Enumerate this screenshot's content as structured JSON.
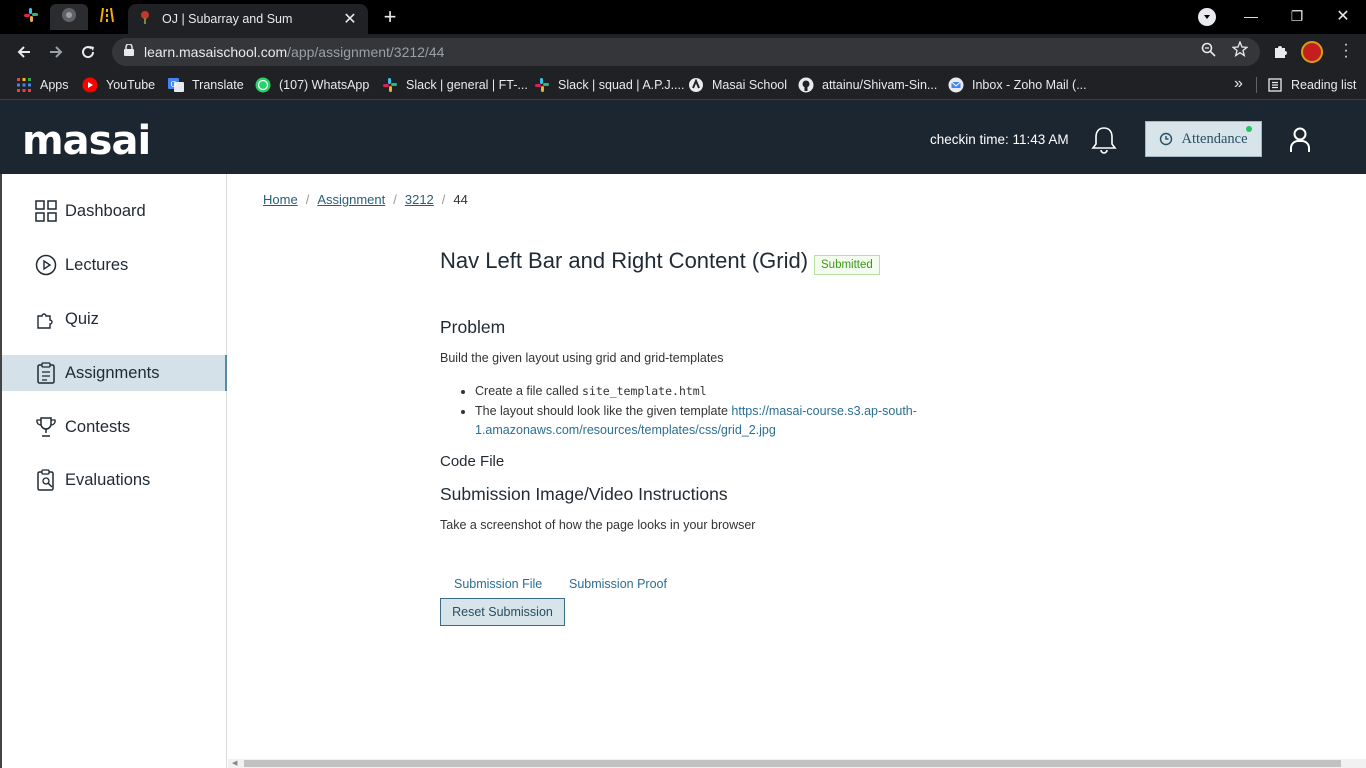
{
  "browser": {
    "active_tab_title": "OJ | Subarray and Sum",
    "url_host": "learn.masaischool.com",
    "url_path": "/app/assignment/3212/44",
    "bookmarks": [
      {
        "label": "Apps",
        "icon": "apps-grid-icon"
      },
      {
        "label": "YouTube",
        "icon": "youtube-icon"
      },
      {
        "label": "Translate",
        "icon": "translate-icon"
      },
      {
        "label": "(107) WhatsApp",
        "icon": "whatsapp-icon"
      },
      {
        "label": "Slack | general | FT-...",
        "icon": "slack-icon"
      },
      {
        "label": "Slack | squad | A.P.J....",
        "icon": "slack-icon"
      },
      {
        "label": "Masai School",
        "icon": "masai-icon"
      },
      {
        "label": "attainu/Shivam-Sin...",
        "icon": "github-icon"
      },
      {
        "label": "Inbox - Zoho Mail (...",
        "icon": "zoho-mail-icon"
      }
    ],
    "more_bookmarks": "»",
    "reading_list": "Reading list"
  },
  "header": {
    "logo": "masai",
    "checkin": "checkin time: 11:43 AM",
    "attendance": "Attendance"
  },
  "sidebar": {
    "items": [
      {
        "label": "Dashboard",
        "icon": "dashboard-grid-icon"
      },
      {
        "label": "Lectures",
        "icon": "play-circle-icon"
      },
      {
        "label": "Quiz",
        "icon": "puzzle-icon"
      },
      {
        "label": "Assignments",
        "icon": "clipboard-icon",
        "active": true
      },
      {
        "label": "Contests",
        "icon": "trophy-icon"
      },
      {
        "label": "Evaluations",
        "icon": "evaluation-icon"
      }
    ]
  },
  "breadcrumb": {
    "items": [
      "Home",
      "Assignment",
      "3212"
    ],
    "current": "44",
    "separator": "/"
  },
  "assignment": {
    "title": "Nav Left Bar and Right Content (Grid)",
    "status": "Submitted",
    "problem_heading": "Problem",
    "problem_text": "Build the given layout using grid and grid-templates",
    "bullet1_prefix": "Create a file called ",
    "bullet1_code": "site_template.html",
    "bullet2_prefix": "The layout should look like the given template ",
    "bullet2_link": "https://masai-course.s3.ap-south-1.amazonaws.com/resources/templates/css/grid_2.jpg",
    "code_file_heading": "Code File",
    "submission_heading": "Submission Image/Video Instructions",
    "submission_text": "Take a screenshot of how the page looks in your browser",
    "submission_file": "Submission File",
    "submission_proof": "Submission Proof",
    "reset_button": "Reset Submission"
  },
  "colors": {
    "header_bg": "#1b2630",
    "accent": "#2a6e93",
    "active_sidebar_bg": "#d4e1e8",
    "badge_green": "#3a9b16"
  }
}
